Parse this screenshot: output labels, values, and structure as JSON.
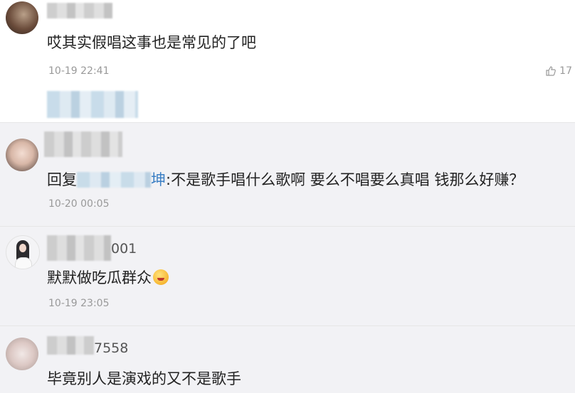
{
  "comments": [
    {
      "text": "哎其实假唱这事也是常见的了吧",
      "time": "10-19 22:41",
      "likes": "17"
    },
    {
      "reply_prefix": "回复",
      "reply_target": "坤",
      "text": ":不是歌手唱什么歌啊 要么不唱要么真唱 钱那么好赚？",
      "time": "10-20 00:05"
    },
    {
      "name_suffix": "001",
      "text": "默默做吃瓜群众",
      "time": "10-19 23:05"
    },
    {
      "name_suffix": "7558",
      "text": "毕竟别人是演戏的又不是歌手"
    }
  ],
  "icons": {
    "like": "thumbs-up-icon",
    "emoji": "melon-eating-emoji-icon"
  },
  "colors": {
    "link": "#3b7fc4",
    "timestamp": "#999999",
    "separator_bg": "#f2f2f5"
  }
}
